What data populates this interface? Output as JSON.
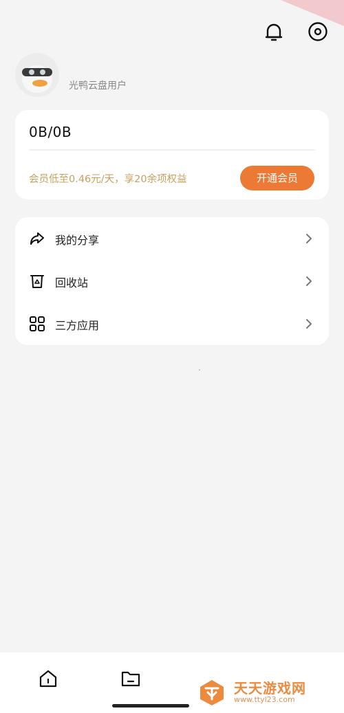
{
  "header": {
    "icons": [
      "bell-icon",
      "settings-icon"
    ]
  },
  "profile": {
    "username": "光鸭云盘用户",
    "avatar_icon": "duck-avatar-icon"
  },
  "storage": {
    "value": "0B/0B",
    "promo_text": "会员低至0.46元/天，享20余项权益",
    "vip_button_label": "开通会员"
  },
  "menu": {
    "items": [
      {
        "label": "我的分享",
        "icon": "share-icon"
      },
      {
        "label": "回收站",
        "icon": "recycle-bin-icon"
      },
      {
        "label": "三方应用",
        "icon": "apps-grid-icon"
      }
    ]
  },
  "bottom_nav": {
    "tabs": [
      {
        "icon": "home-icon"
      },
      {
        "icon": "folder-icon"
      }
    ]
  },
  "watermark": {
    "title": "天天游戏网",
    "url": "www.ttyl23.com"
  },
  "colors": {
    "accent": "#ec7a35",
    "promo": "#c8a05e",
    "background": "#f4f4f4",
    "card": "#ffffff"
  }
}
